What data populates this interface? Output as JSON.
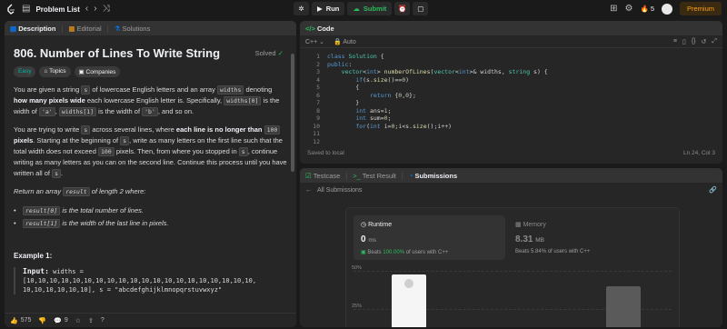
{
  "topbar": {
    "title": "Problem List",
    "run_label": "Run",
    "submit_label": "Submit",
    "streak": "5",
    "premium_label": "Premium"
  },
  "left": {
    "tabs": [
      "Description",
      "Editorial",
      "Solutions"
    ],
    "title": "806. Number of Lines To Write String",
    "solved": "Solved",
    "tags": [
      "Easy",
      "Topics",
      "Companies"
    ],
    "p1": {
      "a": "You are given a string ",
      "s": "s",
      "b": " of lowercase English letters and an array ",
      "widths": "widths",
      "c": " denoting ",
      "bold": "how many pixels wide",
      "d": " each lowercase English letter is. Specifically, ",
      "w0": "widths[0]",
      "e": " is the width of ",
      "a1": "'a'",
      "f": ", ",
      "w1": "widths[1]",
      "g": " is the width of ",
      "b1": "'b'",
      "h": ", and so on."
    },
    "p2": {
      "a": "You are trying to write ",
      "s": "s",
      "b": " across several lines, where ",
      "bold": "each line is no longer than",
      "n100": "100",
      "bold2": "pixels",
      "c": ". Starting at the beginning of ",
      "s2": "s",
      "d": ", write as many letters on the first line such that the total width does not exceed ",
      "n100b": "100",
      "e": " pixels. Then, from where you stopped in ",
      "s3": "s",
      "f": ", continue writing as many letters as you can on the second line. Continue this process until you have written all of ",
      "s4": "s",
      "g": "."
    },
    "p3": {
      "a": "Return an array ",
      "result": "result",
      "b": " of length 2 where:"
    },
    "bullets": [
      {
        "code": "result[0]",
        "text": " is the total number of lines."
      },
      {
        "code": "result[1]",
        "text": " is the width of the last line in pixels."
      }
    ],
    "example_title": "Example 1:",
    "example_input_label": "Input:",
    "example_input_line1": " widths =",
    "example_input_line2": "[10,10,10,10,10,10,10,10,10,10,10,10,10,10,10,10,10,10,10,10,",
    "example_input_line3": "10,10,10,10,10,10], s = \"abcdefghijklmnopqrstuvwxyz\"",
    "likes": "575",
    "comments": "9"
  },
  "code": {
    "title": "Code",
    "language": "C++",
    "mode": "Auto",
    "status_left": "Saved to local",
    "status_right": "Ln 24, Col 3"
  },
  "submissions": {
    "tabs": [
      "Testcase",
      "Test Result",
      "Submissions"
    ],
    "back_label": "All Submissions",
    "runtime_label": "Runtime",
    "runtime_value": "0",
    "runtime_unit": "ms",
    "runtime_beats_pre": "Beats ",
    "runtime_beats_pct": "100.00%",
    "runtime_beats_post": " of users with C++",
    "memory_label": "Memory",
    "memory_value": "8.31",
    "memory_unit": "MB",
    "memory_beats": "Beats 5.84% of users with C++",
    "gridlabels": [
      "50%",
      "25%"
    ]
  }
}
